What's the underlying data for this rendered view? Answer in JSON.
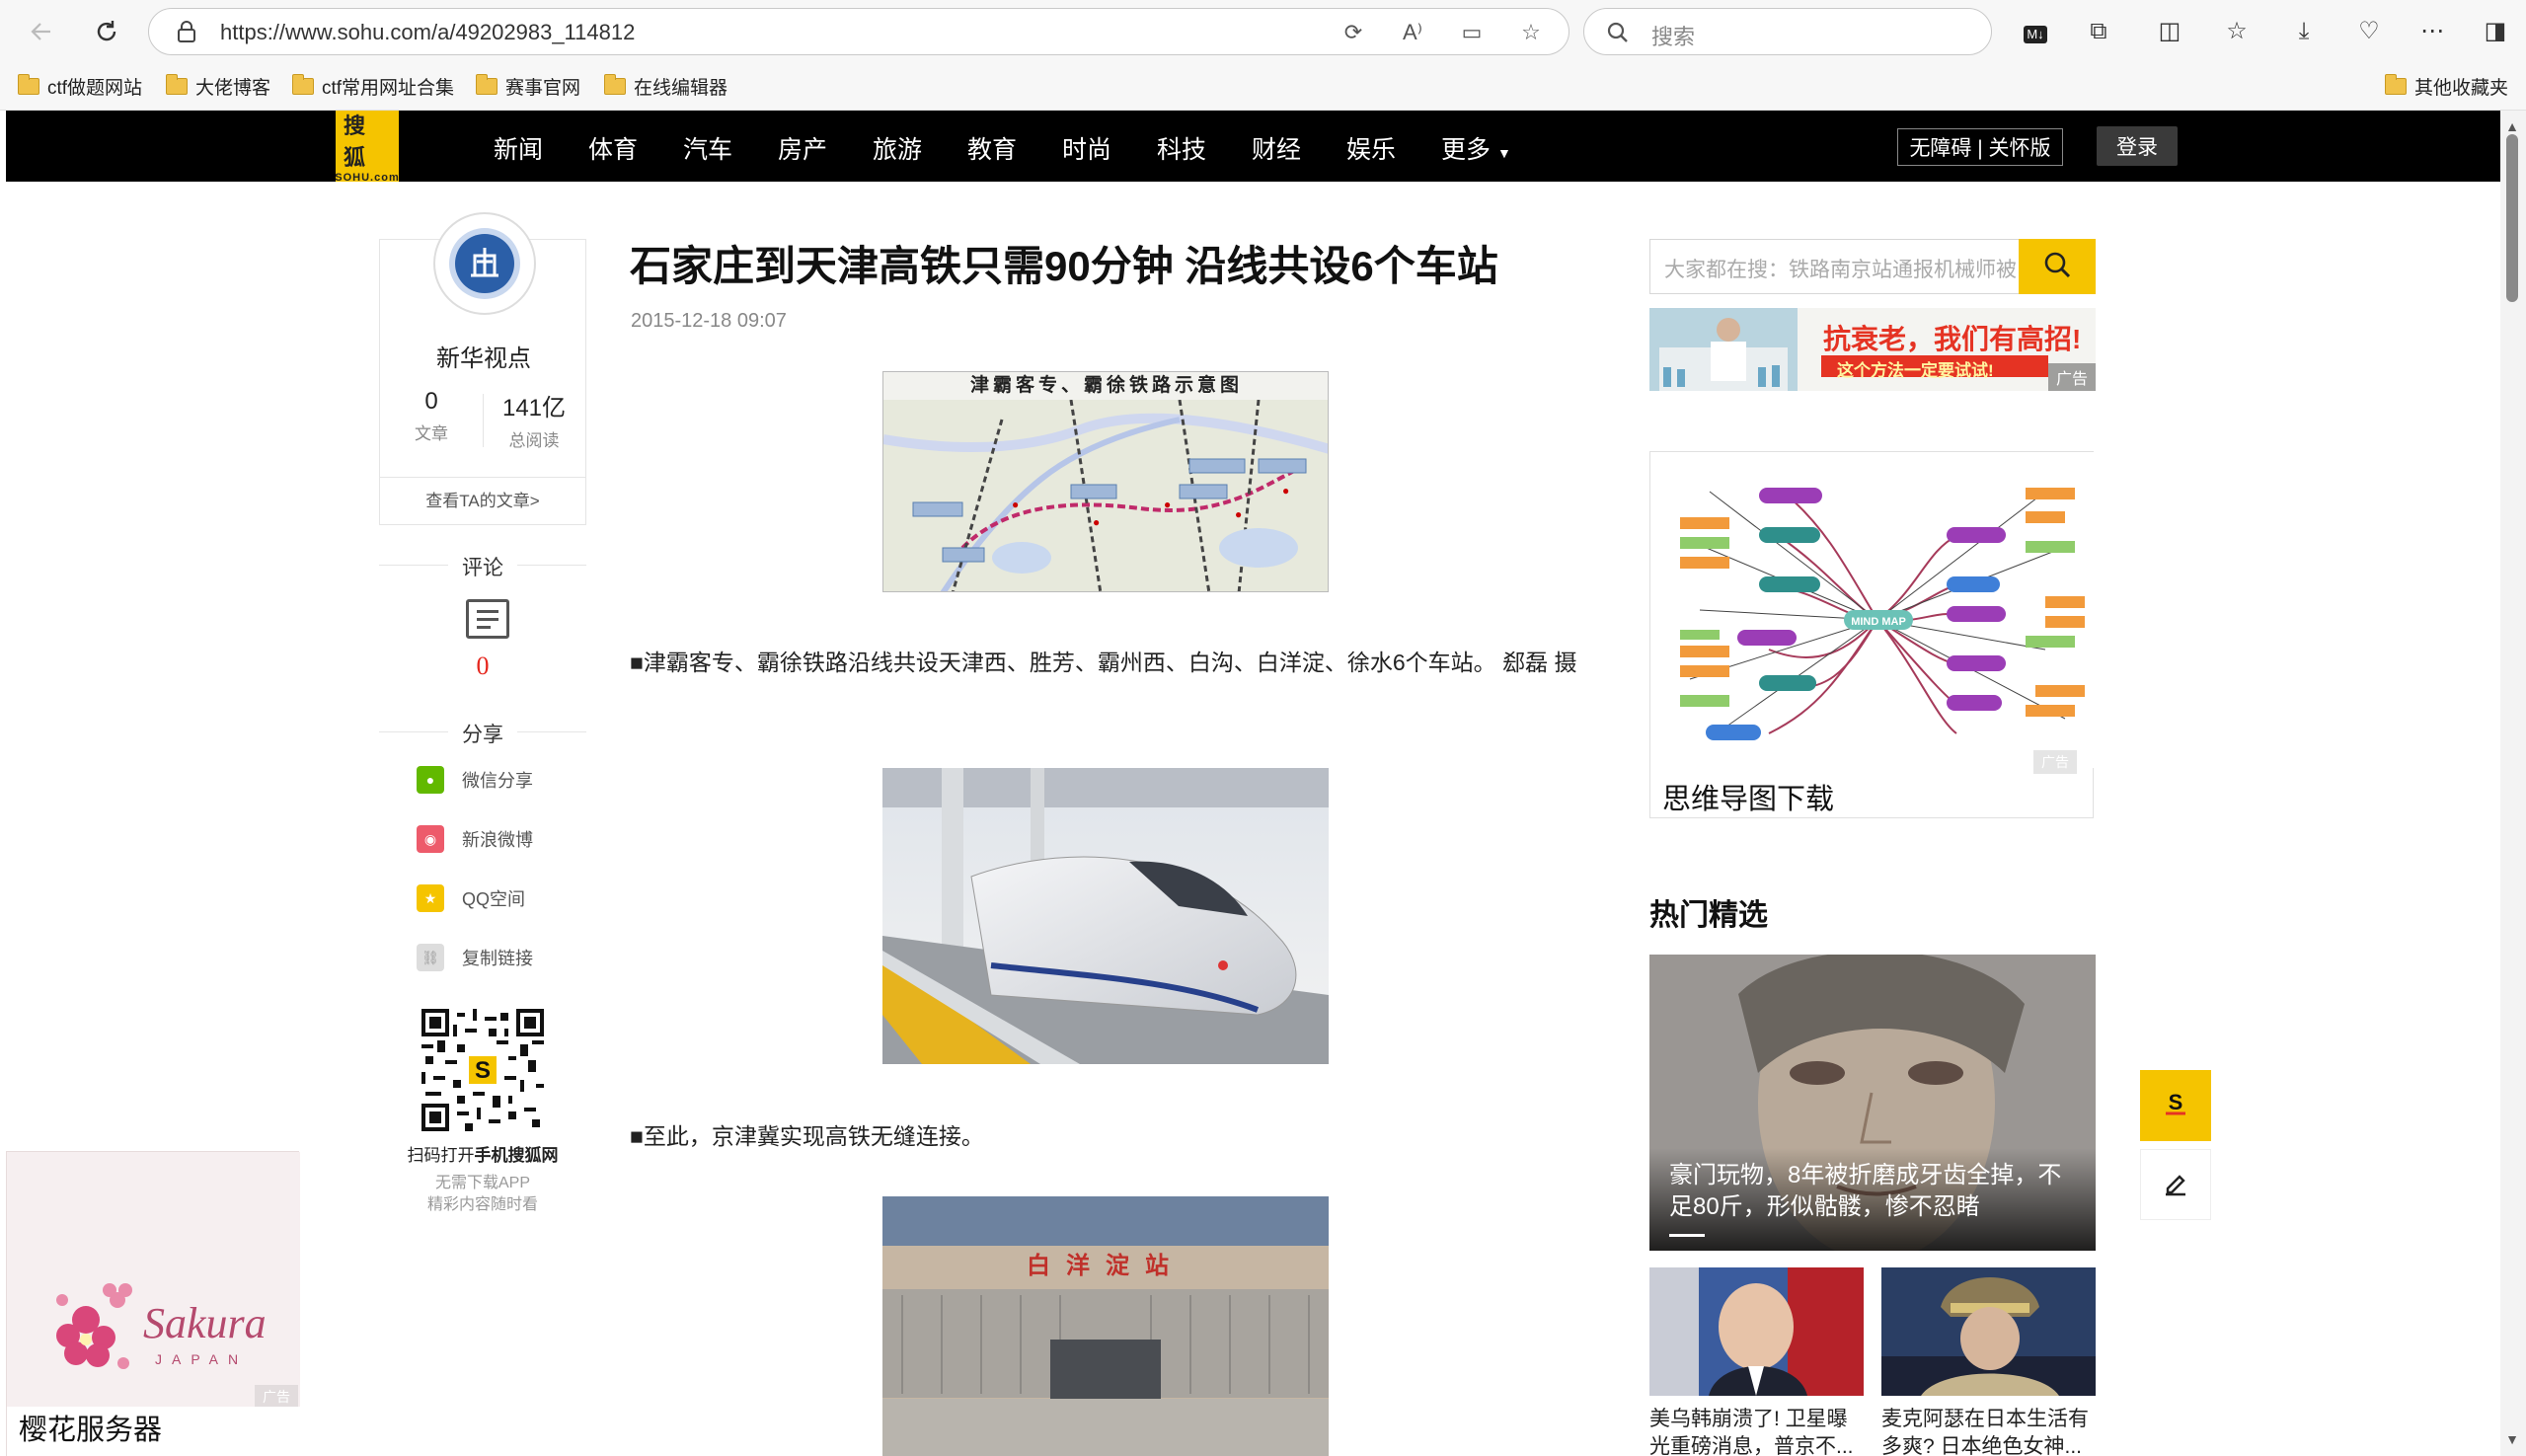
{
  "browser": {
    "url": "https://www.sohu.com/a/49202983_114812",
    "search_placeholder": "搜索",
    "bookmarks": [
      "ctf做题网站",
      "大佬博客",
      "ctf常用网址合集",
      "赛事官网",
      "在线编辑器"
    ],
    "other_bookmarks": "其他收藏夹"
  },
  "sohu_nav": {
    "logo_cn": "搜狐",
    "logo_en": "SOHU.com",
    "links": [
      "新闻",
      "体育",
      "汽车",
      "房产",
      "旅游",
      "教育",
      "时尚",
      "科技",
      "财经",
      "娱乐",
      "更多"
    ],
    "accessibility": "无障碍 | 关怀版",
    "login": "登录"
  },
  "author": {
    "name": "新华视点",
    "articles_count": "0",
    "articles_label": "文章",
    "reads_count": "141亿",
    "reads_label": "总阅读",
    "view_articles": "查看TA的文章>"
  },
  "sidebar": {
    "comment_title": "评论",
    "comment_count": "0",
    "share_title": "分享",
    "share_items": [
      "微信分享",
      "新浪微博",
      "QQ空间",
      "复制链接"
    ],
    "qr_line1_prefix": "扫码打开",
    "qr_line1_bold": "手机搜狐网",
    "qr_line2": "无需下载APP",
    "qr_line3": "精彩内容随时看"
  },
  "article": {
    "title": "石家庄到天津高铁只需90分钟 沿线共设6个车站",
    "time": "2015-12-18 09:07",
    "map_title": "津霸客专、霸徐铁路示意图",
    "para1": "■津霸客专、霸徐铁路沿线共设天津西、胜芳、霸州西、白沟、白洋淀、徐水6个车站。 郄磊 摄",
    "para2": "■至此，京津冀实现高铁无缝连接。",
    "station_sign": "白洋淀站"
  },
  "right": {
    "search_placeholder": "大家都在搜：铁路南京站通报机械师被",
    "ad_text": "抗衰老，我们有高招!",
    "ad_subtext": "这个方法一定要试试!",
    "ad_label": "广告",
    "mindmap_center": "MIND MAP",
    "mindmap_caption": "思维导图下载",
    "hot_title": "热门精选",
    "hot_main_caption": "豪门玩物，8年被折磨成牙齿全掉，不足80斤，形似骷髅，惨不忍睹",
    "hot_small": [
      "美乌韩崩溃了! 卫星曝光重磅消息，普京不...",
      "麦克阿瑟在日本生活有多爽? 日本绝色女神..."
    ]
  },
  "sakura_ad": {
    "brand": "Sakura",
    "sub": "JAPAN",
    "label": "樱花服务器",
    "ad_label": "广告"
  }
}
